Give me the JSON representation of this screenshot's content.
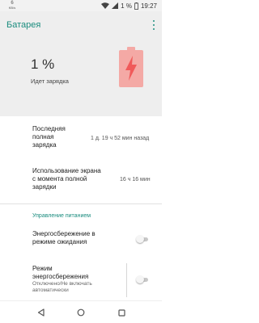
{
  "status_bar": {
    "speed_value": "6",
    "speed_unit": "KB/s",
    "battery_percent": "1 %",
    "time": "19:27"
  },
  "header": {
    "title": "Батарея",
    "battery_level": "1 %",
    "charging_state": "Идет зарядка",
    "accent_color": "#1a8c7e",
    "battery_icon_color": "#f05a5a"
  },
  "rows": {
    "last_full_charge": {
      "label_line1": "Последняя",
      "label_line2": "полная",
      "label_line3": "зарядка",
      "value": "1 д. 19 ч 52 мин назад"
    },
    "screen_usage": {
      "label_line1": "Использование экрана",
      "label_line2": "с момента полной",
      "label_line3": "зарядки",
      "value": "16 ч 16 мин"
    }
  },
  "power_section": {
    "title": "Управление питанием",
    "standby_saver": {
      "label_line1": "Энергосбережение в",
      "label_line2": "режиме ожидания",
      "enabled": false
    },
    "battery_saver": {
      "label_line1": "Режим",
      "label_line2": "энергосбережения",
      "sub_line1": "Отключено/Не включать",
      "sub_line2": "автоматически",
      "enabled": false
    }
  },
  "icons": {
    "wifi": "wifi-icon",
    "signal": "signal-icon",
    "battery": "battery-charging-icon",
    "back": "back-icon",
    "home": "home-icon",
    "recents": "recents-icon"
  }
}
